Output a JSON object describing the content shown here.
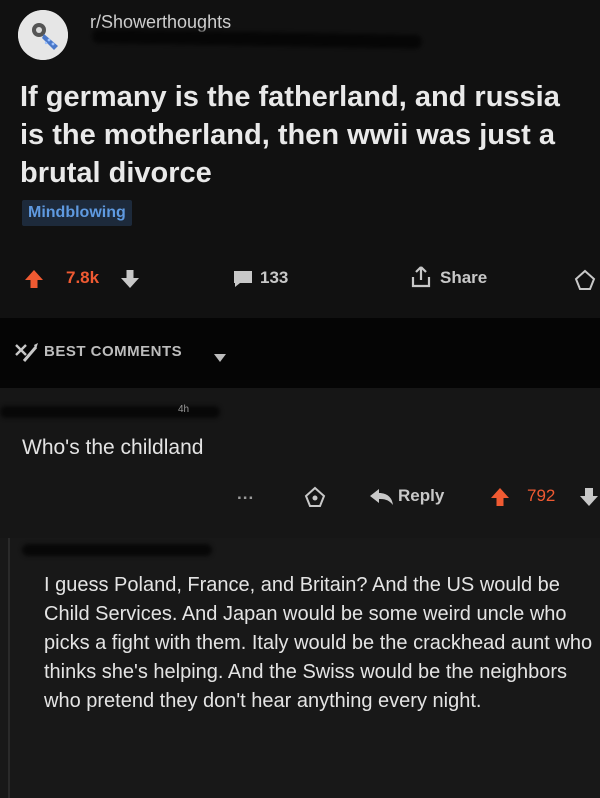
{
  "post": {
    "subreddit": "r/Showerthoughts",
    "title": "If germany is the fatherland, and russia is the motherland, then wwii was just a brutal divorce",
    "flair": "Mindblowing",
    "score": "7.8k",
    "comment_count": "133",
    "share_label": "Share"
  },
  "sort": {
    "label": "BEST COMMENTS"
  },
  "comments": [
    {
      "age": "4h",
      "text": "Who's the childland",
      "more": "...",
      "reply_label": "Reply",
      "score": "792"
    },
    {
      "text": "I guess Poland, France, and Britain? And the US would be Child Services. And Japan would be some weird uncle who picks a fight with them. Italy would be the crackhead aunt who thinks she's helping. And the Swiss would be the neighbors who pretend they don't hear anything every night."
    }
  ],
  "colors": {
    "upvote": "#ef5a32",
    "flair_text": "#5f9ae0",
    "background": "#151515"
  },
  "icons": [
    "subreddit-avatar-icon",
    "upvote-icon",
    "downvote-icon",
    "comment-icon",
    "share-icon",
    "save-icon",
    "best-comments-icon",
    "chevron-down-icon",
    "more-icon",
    "reply-icon"
  ]
}
